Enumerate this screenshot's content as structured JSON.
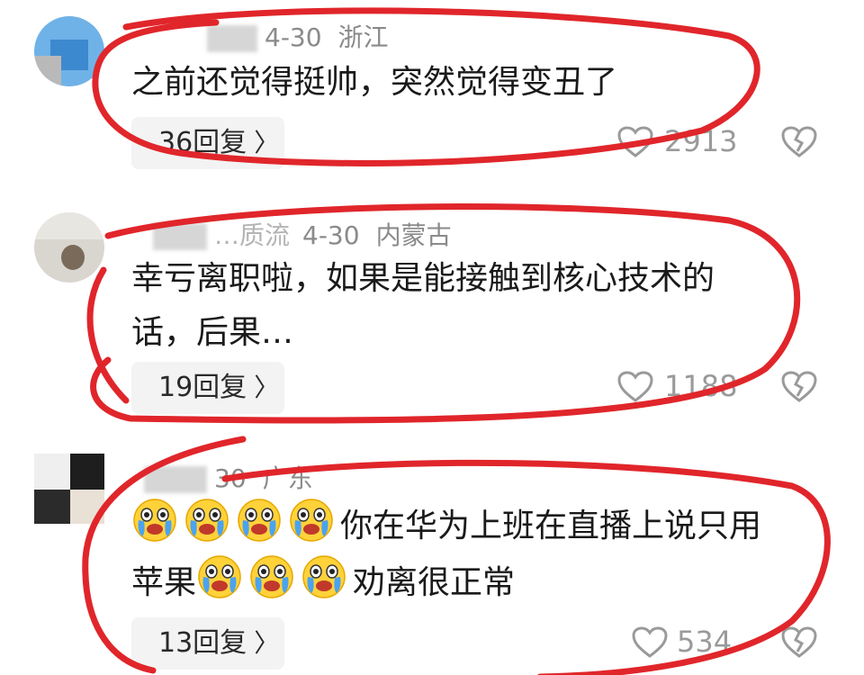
{
  "comments": [
    {
      "date": "4-30",
      "location": "浙江",
      "text": "之前还觉得挺帅，突然觉得变丑了",
      "reply_label": "36回复",
      "likes": "2913"
    },
    {
      "name": "…质流",
      "date": "4-30",
      "location": "内蒙古",
      "text_line1": "幸亏离职啦，如果是能接触到核心技术的",
      "text_line2": "话，后果…",
      "reply_label": "19回复",
      "likes": "1188"
    },
    {
      "date": "30",
      "location": "广东",
      "text_line1": "你在华为上班在直播上说只用",
      "text_line2_a": "苹果",
      "text_line2_b": "劝离很正常",
      "reply_label": "13回复",
      "likes": "534"
    }
  ],
  "icons": {
    "like": "heart-outline-icon",
    "dislike": "broken-heart-icon",
    "reply_chevron": "chevron-right-icon",
    "emoji": "crying-face-emoji"
  },
  "colors": {
    "annotation_circle": "#e0262b",
    "meta_text": "#8a8a8a",
    "reply_bg": "#f3f3f3"
  }
}
